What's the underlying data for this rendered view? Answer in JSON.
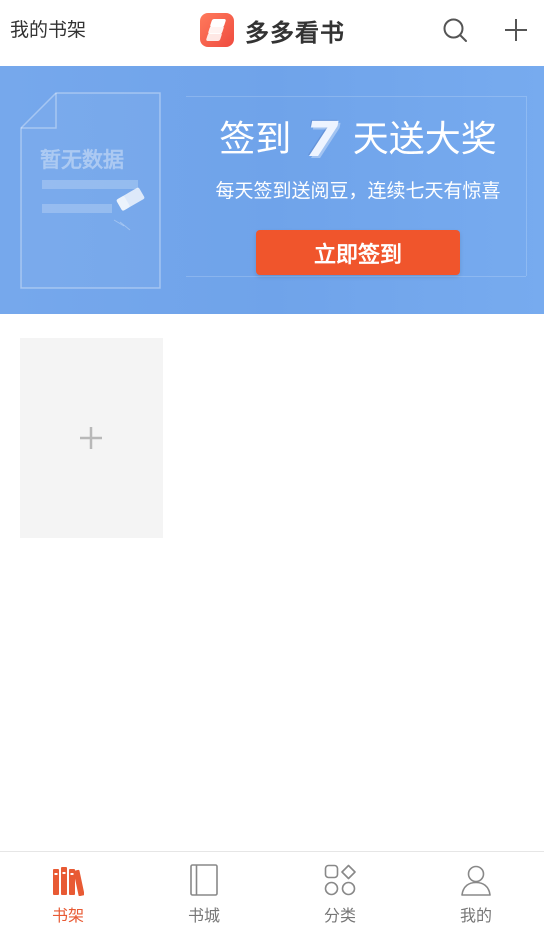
{
  "header": {
    "left_label": "我的书架",
    "brand_name": "多多看书",
    "icons": {
      "search": "search-icon",
      "add": "plus-icon",
      "brand": "app-logo"
    }
  },
  "banner": {
    "empty_label": "暂无数据",
    "title_prefix": "签到",
    "title_number": "7",
    "title_suffix": "天送大奖",
    "subtitle": "每天签到送阅豆，连续七天有惊喜",
    "signin_button": "立即签到",
    "colors": {
      "banner_bg": "#72a6ec",
      "button_bg": "#f0552c"
    }
  },
  "shelf": {
    "add_card_icon": "plus-icon"
  },
  "bottom_nav": {
    "items": [
      {
        "label": "书架",
        "icon": "bookshelf-icon",
        "active": true
      },
      {
        "label": "书城",
        "icon": "book-icon",
        "active": false
      },
      {
        "label": "分类",
        "icon": "category-grid-icon",
        "active": false
      },
      {
        "label": "我的",
        "icon": "user-icon",
        "active": false
      }
    ],
    "colors": {
      "active": "#e85a34",
      "inactive": "#777777"
    }
  }
}
